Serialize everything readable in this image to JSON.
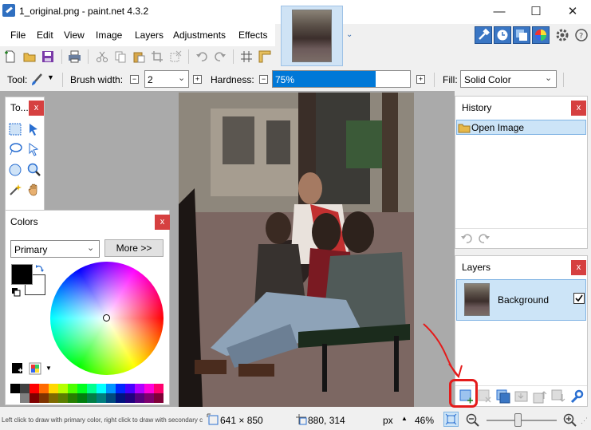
{
  "window": {
    "title": "1_original.png - paint.net 4.3.2",
    "minimize": "—",
    "maximize": "☐",
    "close": "✕"
  },
  "menu": [
    "File",
    "Edit",
    "View",
    "Image",
    "Layers",
    "Adjustments",
    "Effects"
  ],
  "toolbar": {
    "tool_label": "Tool:",
    "brush_width_label": "Brush width:",
    "brush_width_value": "2",
    "hardness_label": "Hardness:",
    "hardness_value": "75%",
    "hardness_fraction": 0.75,
    "fill_label": "Fill:",
    "fill_value": "Solid Color"
  },
  "tools_panel": {
    "title": "To...",
    "close": "x"
  },
  "colors_panel": {
    "title": "Colors",
    "close": "x",
    "mode": "Primary",
    "more_button": "More >>",
    "palette": [
      "#000000",
      "#404040",
      "#ff0000",
      "#ff6a00",
      "#ffd800",
      "#b6ff00",
      "#4cff00",
      "#00ff21",
      "#00ff90",
      "#00ffff",
      "#0094ff",
      "#0026ff",
      "#4800ff",
      "#b200ff",
      "#ff00dc",
      "#ff006e",
      "#ffffff",
      "#808080",
      "#7f0000",
      "#7f3300",
      "#7f6a00",
      "#5b7f00",
      "#267f00",
      "#007f0e",
      "#007f46",
      "#007f7f",
      "#004a7f",
      "#00137f",
      "#21007f",
      "#57007f",
      "#7f006e",
      "#7f0037"
    ]
  },
  "history_panel": {
    "title": "History",
    "close": "x",
    "items": [
      "Open Image"
    ]
  },
  "layers_panel": {
    "title": "Layers",
    "close": "x",
    "layers": [
      {
        "name": "Background",
        "visible": true
      }
    ]
  },
  "status": {
    "hint": "Left click to draw with primary color, right click to draw with secondary col...",
    "image_size": "641 × 850",
    "cursor_pos": "880, 314",
    "units": "px",
    "units_arrow": "▲",
    "zoom": "46%",
    "zoom_fraction": 0.46
  },
  "colors": {
    "accent": "#0078d7",
    "selection": "#cce4f7",
    "close_red": "#d64040",
    "annotation_red": "#e41b1b"
  }
}
